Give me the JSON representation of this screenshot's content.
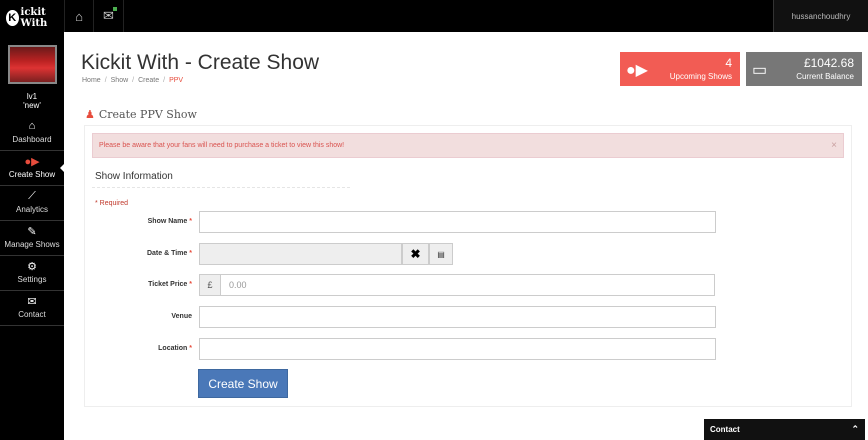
{
  "brand": {
    "logo_letter": "K",
    "logo_text": "ickit With"
  },
  "user": {
    "line1": "lv1",
    "line2": "'new'"
  },
  "sidebar": {
    "items": [
      {
        "label": "Dashboard",
        "icon": "home-icon"
      },
      {
        "label": "Create Show",
        "icon": "camera-icon",
        "active": true
      },
      {
        "label": "Analytics",
        "icon": "chart-icon"
      },
      {
        "label": "Manage Shows",
        "icon": "pencil-icon"
      },
      {
        "label": "Settings",
        "icon": "gear-icon"
      },
      {
        "label": "Contact",
        "icon": "envelope-icon"
      }
    ]
  },
  "topbar": {
    "username": "hussanchoudhry"
  },
  "page": {
    "title": "Kickit With - Create Show"
  },
  "breadcrumb": [
    "Home",
    "Show",
    "Create",
    "PPV"
  ],
  "stats": {
    "upcoming": {
      "value": "4",
      "label": "Upcoming Shows"
    },
    "balance": {
      "value": "£1042.68",
      "label": "Current Balance"
    }
  },
  "section": {
    "title": "Create PPV Show"
  },
  "alert": {
    "text": "Please be aware that your fans will need to purchase a ticket to view this show!",
    "close": "×"
  },
  "form": {
    "title": "Show Information",
    "required_note": "* Required",
    "show_name_label": "Show Name",
    "date_label": "Date & Time",
    "price_label": "Ticket Price",
    "currency": "£",
    "price_placeholder": "0.00",
    "venue_label": "Venue",
    "location_label": "Location",
    "submit": "Create Show"
  },
  "contact_bar": {
    "label": "Contact"
  },
  "colors": {
    "accent": "#f25c54",
    "primary_button": "#4a78b8",
    "balance_box": "#777777"
  }
}
